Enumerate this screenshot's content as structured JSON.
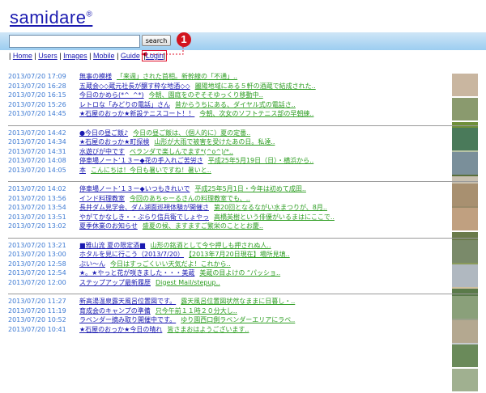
{
  "logo": {
    "text": "samidare",
    "mark": "®"
  },
  "search": {
    "value": "",
    "button_label": "search"
  },
  "nav": {
    "sep": "|",
    "items": [
      "Home",
      "Users",
      "Images",
      "Mobile",
      "Guide",
      "Login"
    ]
  },
  "callout": {
    "number": "1"
  },
  "colors": {
    "link": "#1a1ab0",
    "date": "#3d7ad3",
    "snippet": "#2e9e23",
    "highlight": "#e0102a"
  },
  "groups": [
    {
      "thumbs": [
        "#c9b6a0",
        "#8a9a6e",
        "#6f8f3a",
        "#b8c4a6",
        "#5a6f3a"
      ],
      "rows": [
        {
          "date": "2013/07/20 17:09",
          "title": "無事の模様",
          "snippet": "「来週」された首相。新幹線の「不通」.."
        },
        {
          "date": "2013/07/20 16:28",
          "title": "五蔵会◇◇蔵元社長が醸す粋な地酒◇◇",
          "snippet": "麗陽地域にある５軒の酒蔵で結成された.."
        },
        {
          "date": "2013/07/20 16:15",
          "title": "今日のかめら(*^_^*)",
          "snippet": "今朝、園庭をのぞそそゆっくり移動中.."
        },
        {
          "date": "2013/07/20 15:26",
          "title": "レトロな「みどりの電話」さん",
          "snippet": "昔からうちにある、ダイヤル式の電話さ.."
        },
        {
          "date": "2013/07/20 14:45",
          "title": "★石屋のおっか★新設テニスコート！！",
          "snippet": "今朝、次女のソフトテニス部の早朝練.."
        }
      ]
    },
    {
      "thumbs": [
        "#4a7a5a",
        "#7a8f9a",
        "#c8c0b0",
        "#9a8a6a"
      ],
      "rows": [
        {
          "date": "2013/07/20 14:42",
          "title": "●今日の昼ご飯♪",
          "snippet": "今日の昼ご飯は、（個人的に）夏の定番.."
        },
        {
          "date": "2013/07/20 14:34",
          "title": "★石屋のおっか★町探検",
          "snippet": "山形が大雨で被害を受けたあの日。私達.."
        },
        {
          "date": "2013/07/20 14:31",
          "title": "水遊びが中です",
          "snippet": "ベランダで楽しんでます*(^o^)/*.."
        },
        {
          "date": "2013/07/20 14:08",
          "title": "停車場ノート’１３ー◆花の手入れご苦労さ",
          "snippet": "平成25年5月19日（日）・横浜から.."
        },
        {
          "date": "2013/07/20 14:05",
          "title": "本",
          "snippet": "こんにちは！今日も暑いですね！暑いと.."
        }
      ]
    },
    {
      "thumbs": [
        "#a89070",
        "#c0a080",
        "#6a7a4a",
        "#8a9a5a",
        "#d0c0a0"
      ],
      "rows": [
        {
          "date": "2013/07/20 14:02",
          "title": "停車場ノート’１３ー◆いつもきれいで",
          "snippet": "平成25年5月1日・今年は初めて成田.."
        },
        {
          "date": "2013/07/20 13:56",
          "title": "インド料理教室",
          "snippet": "今回のあちゃーるさんの料理教室でも、.."
        },
        {
          "date": "2013/07/20 13:54",
          "title": "長井ダム見学会、ダム湖面巡視体験が開催さ",
          "snippet": "第20回となるながい水まつりが、8月.."
        },
        {
          "date": "2013/07/20 13:51",
          "title": "やがてかなしき・・ぶらり信兵衛でしょやっ",
          "snippet": "高橋英樹という俳優がいるまはにここで.."
        },
        {
          "date": "2013/07/20 13:02",
          "title": "夏季休業のお知らせ",
          "snippet": "盛夏の候、ますますご繁栄のこととお慶.."
        }
      ]
    },
    {
      "thumbs": [
        "#7a8a6a",
        "#b0b8c0",
        "#5a7a4a",
        "#9aa08a",
        "#c8ccd0"
      ],
      "rows": [
        {
          "date": "2013/07/20 13:21",
          "title": "■雅山流 夏の限定酒■",
          "snippet": "山形の銘酒として今や押しも押されぬ人.."
        },
        {
          "date": "2013/07/20 13:00",
          "title": "ホタルを見に行こう（2013/7/20）",
          "snippet": "【2013年7月20日現在】場所見填.."
        },
        {
          "date": "2013/07/20 12:58",
          "title": "ぶい〜ん",
          "snippet": "今日はすっごくいい天気だよ！これから.."
        },
        {
          "date": "2013/07/20 12:54",
          "title": "★。★やっと花が咲きました・・・美蔵",
          "snippet": "美蔵の目よけの “パッショ.."
        },
        {
          "date": "2013/07/20 12:00",
          "title": "ステップアップ最新履歴",
          "snippet": "Digest Mail/stepup.."
        }
      ]
    },
    {
      "thumbs": [
        "#8aa07a",
        "#b4a890",
        "#6a8a5a",
        "#a0b090"
      ],
      "rows": [
        {
          "date": "2013/07/20 11:27",
          "title": "新高湯温泉露天風呂位置図です。",
          "snippet": "露天風呂位置図状然なままに日暮し・.."
        },
        {
          "date": "2013/07/20 11:19",
          "title": "育成会のキャンプの準備",
          "snippet": "只今午前１１時２０分大し.."
        },
        {
          "date": "2013/07/20 10:52",
          "title": "ラベンダー摘み取り開催中です。",
          "snippet": "ゆり園西口側ラベンダーエリアにラベ.."
        },
        {
          "date": "2013/07/20 10:41",
          "title": "★石屋のおっか★今日の晴れ",
          "snippet": "皆さまおはようございます.."
        }
      ]
    }
  ]
}
